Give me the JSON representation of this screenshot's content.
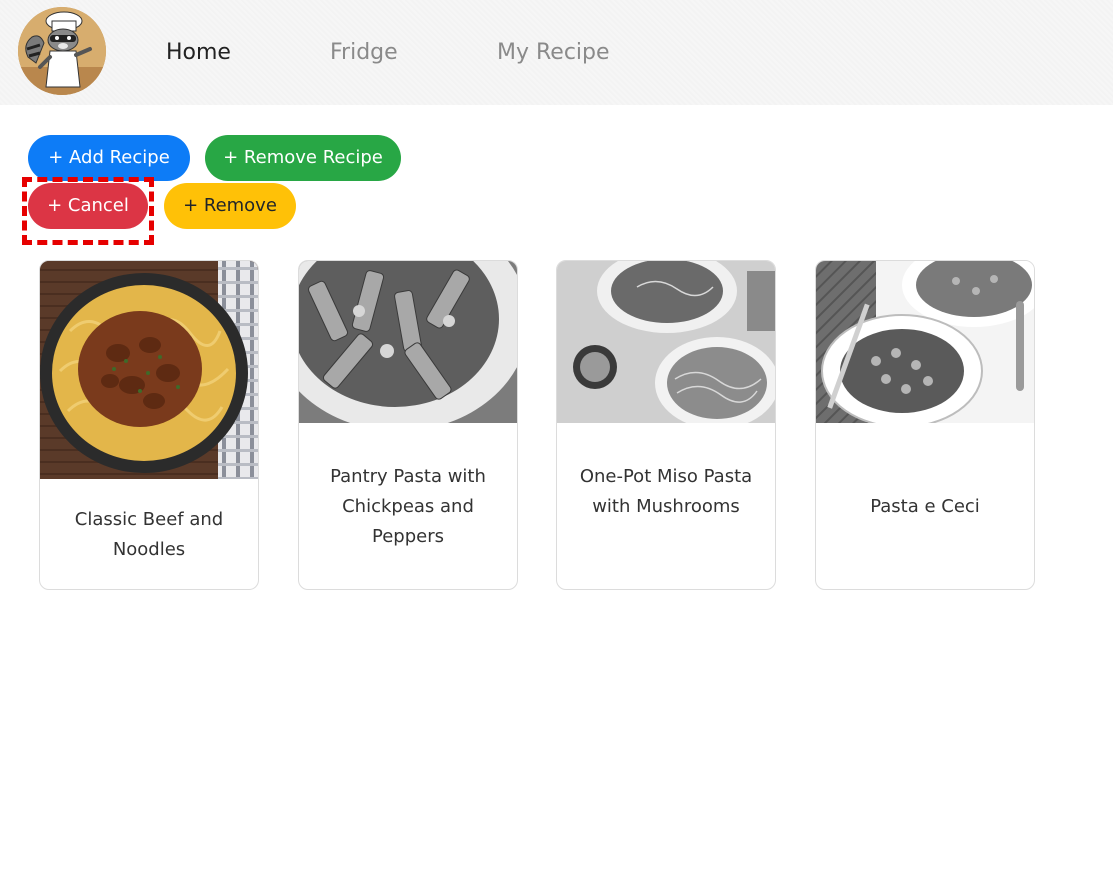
{
  "nav": {
    "links": [
      {
        "label": "Home",
        "active": true
      },
      {
        "label": "Fridge",
        "active": false
      },
      {
        "label": "My Recipe",
        "active": false
      }
    ]
  },
  "actions": {
    "add_recipe": "+ Add Recipe",
    "remove_recipe": "+ Remove Recipe",
    "cancel": "+ Cancel",
    "remove": "+ Remove"
  },
  "recipes": [
    {
      "title": "Classic Beef and Noodles",
      "image": "beef-noodles-color-photo"
    },
    {
      "title": "Pantry Pasta with Chickpeas and Peppers",
      "image": "penne-bowl-grayscale-photo"
    },
    {
      "title": "One-Pot Miso Pasta with Mushrooms",
      "image": "miso-pasta-grayscale-photo"
    },
    {
      "title": "Pasta e Ceci",
      "image": "pasta-ceci-grayscale-photo"
    }
  ],
  "colors": {
    "primary": "#0d7cf7",
    "success": "#28a745",
    "danger": "#dc3545",
    "warning": "#ffc107",
    "highlight": "#e60000"
  }
}
